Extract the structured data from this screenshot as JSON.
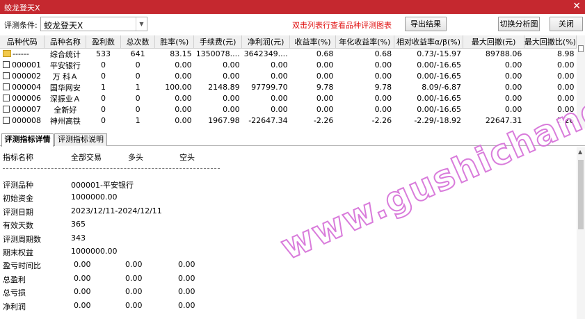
{
  "window": {
    "title": "蛟龙登天X"
  },
  "toolbar": {
    "condition_label": "评测条件:",
    "condition_value": "蛟龙登天X",
    "hint": "双击列表行查看品种评测图表",
    "export_label": "导出结果",
    "switch_label": "切换分析图",
    "close_label": "关闭"
  },
  "columns": [
    "品种代码",
    "品种名称",
    "盈利数",
    "总次数",
    "胜率(%)",
    "手续费(元)",
    "净利润(元)",
    "收益率(%)",
    "年化收益率(%)",
    "相对收益率α/β(%)",
    "最大回撤(元)",
    "最大回撤比(%)"
  ],
  "rows": [
    {
      "code": "------",
      "name": "综合统计",
      "win": "533",
      "total": "641",
      "rate": "83.15",
      "fee": "1350078....",
      "profit": "3642349....",
      "ret": "0.68",
      "annual": "0.68",
      "rel": "0.73/-15.97",
      "dd": "89788.06",
      "ddr": "8.98"
    },
    {
      "code": "000001",
      "name": "平安银行",
      "win": "0",
      "total": "0",
      "rate": "0.00",
      "fee": "0.00",
      "profit": "0.00",
      "ret": "0.00",
      "annual": "0.00",
      "rel": "0.00/-16.65",
      "dd": "0.00",
      "ddr": "0.00"
    },
    {
      "code": "000002",
      "name": "万 科Ａ",
      "win": "0",
      "total": "0",
      "rate": "0.00",
      "fee": "0.00",
      "profit": "0.00",
      "ret": "0.00",
      "annual": "0.00",
      "rel": "0.00/-16.65",
      "dd": "0.00",
      "ddr": "0.00"
    },
    {
      "code": "000004",
      "name": "国华网安",
      "win": "1",
      "total": "1",
      "rate": "100.00",
      "fee": "2148.89",
      "profit": "97799.70",
      "ret": "9.78",
      "annual": "9.78",
      "rel": "8.09/-6.87",
      "dd": "0.00",
      "ddr": "0.00"
    },
    {
      "code": "000006",
      "name": "深振业Ａ",
      "win": "0",
      "total": "0",
      "rate": "0.00",
      "fee": "0.00",
      "profit": "0.00",
      "ret": "0.00",
      "annual": "0.00",
      "rel": "0.00/-16.65",
      "dd": "0.00",
      "ddr": "0.00"
    },
    {
      "code": "000007",
      "name": "全新好",
      "win": "0",
      "total": "0",
      "rate": "0.00",
      "fee": "0.00",
      "profit": "0.00",
      "ret": "0.00",
      "annual": "0.00",
      "rel": "0.00/-16.65",
      "dd": "0.00",
      "ddr": "0.00"
    },
    {
      "code": "000008",
      "name": "神州高铁",
      "win": "0",
      "total": "1",
      "rate": "0.00",
      "fee": "1967.98",
      "profit": "-22647.34",
      "ret": "-2.26",
      "annual": "-2.26",
      "rel": "-2.29/-18.92",
      "dd": "22647.31",
      "ddr": "2.26"
    }
  ],
  "tabs": [
    "评测指标详情",
    "评测指标说明"
  ],
  "detail": {
    "header": [
      "指标名称",
      "全部交易",
      "多头",
      "空头"
    ],
    "items": [
      {
        "label": "评测品种",
        "v1": "000001-平安银行"
      },
      {
        "label": "初始资金",
        "v1": "1000000.00"
      },
      {
        "label": "评测日期",
        "v1": "2023/12/11-2024/12/11"
      },
      {
        "label": "有效天数",
        "v1": "365"
      },
      {
        "label": "评测周期数",
        "v1": "343"
      },
      {
        "label": "期末权益",
        "v1": "1000000.00"
      },
      {
        "label": "盈亏时间比",
        "v1": "0.00",
        "v2": "0.00",
        "v3": "0.00"
      },
      {
        "label": "总盈利",
        "v1": "0.00",
        "v2": "0.00",
        "v3": "0.00"
      },
      {
        "label": "总亏损",
        "v1": "0.00",
        "v2": "0.00",
        "v3": "0.00"
      },
      {
        "label": "净利润",
        "v1": "0.00",
        "v2": "0.00",
        "v3": "0.00"
      }
    ]
  },
  "watermark": "www.gushichanghong.com"
}
